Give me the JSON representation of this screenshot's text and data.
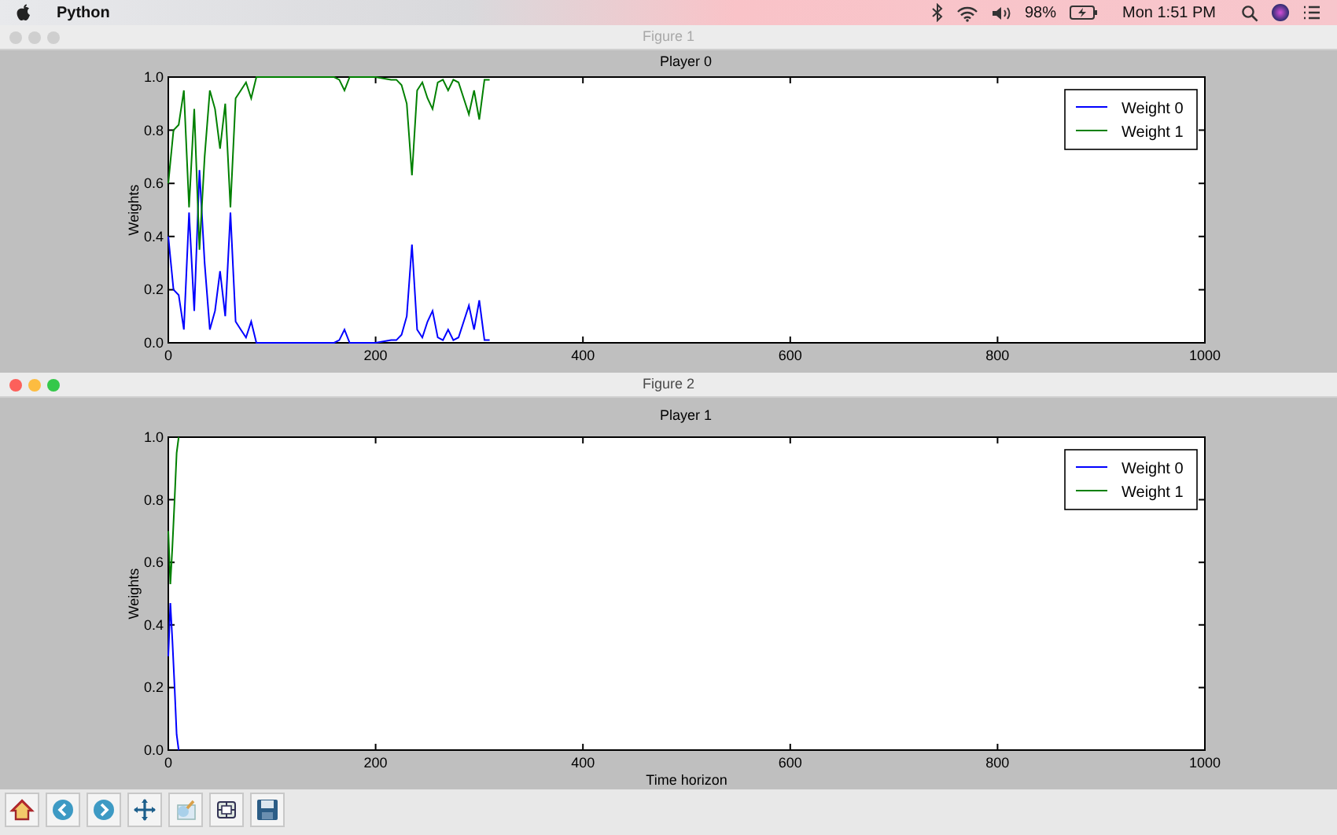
{
  "menu_bar": {
    "app_name": "Python",
    "battery_percent": "98%",
    "clock": "Mon 1:51 PM"
  },
  "windows": [
    {
      "title": "Figure 1",
      "active": false,
      "chart_data": {
        "type": "line",
        "title": "Player 0",
        "legend": "upper right",
        "ylabel": "Weights",
        "xlim": [
          0,
          1000
        ],
        "ylim": [
          0,
          1
        ],
        "xticks": [
          0,
          200,
          400,
          600,
          800,
          1000
        ],
        "yticks": [
          {
            "value": 0,
            "label": "0.0"
          },
          {
            "value": 0.2,
            "label": "0.2"
          },
          {
            "value": 0.4,
            "label": "0.4"
          },
          {
            "value": 0.6,
            "label": "0.6"
          },
          {
            "value": 0.8,
            "label": "0.8"
          },
          {
            "value": 1,
            "label": "1.0"
          }
        ],
        "x": [
          0,
          5,
          10,
          15,
          20,
          25,
          30,
          35,
          40,
          45,
          50,
          55,
          60,
          65,
          70,
          75,
          80,
          85,
          90,
          100,
          120,
          140,
          160,
          165,
          170,
          175,
          180,
          200,
          215,
          220,
          225,
          230,
          235,
          240,
          245,
          250,
          255,
          260,
          265,
          270,
          275,
          280,
          285,
          290,
          295,
          300,
          305,
          310
        ],
        "series": [
          {
            "name": "Weight 0",
            "color": "#0000ff",
            "values": [
              0.4,
              0.2,
              0.18,
              0.05,
              0.49,
              0.12,
              0.65,
              0.3,
              0.05,
              0.12,
              0.27,
              0.1,
              0.49,
              0.08,
              0.05,
              0.02,
              0.08,
              0.0,
              0.0,
              0.0,
              0.0,
              0.0,
              0.0,
              0.01,
              0.05,
              0.0,
              0.0,
              0.0,
              0.01,
              0.01,
              0.03,
              0.1,
              0.37,
              0.05,
              0.02,
              0.08,
              0.12,
              0.02,
              0.01,
              0.05,
              0.01,
              0.02,
              0.08,
              0.14,
              0.05,
              0.16,
              0.01,
              0.01
            ]
          },
          {
            "name": "Weight 1",
            "color": "#008000",
            "values": [
              0.6,
              0.8,
              0.82,
              0.95,
              0.51,
              0.88,
              0.35,
              0.7,
              0.95,
              0.88,
              0.73,
              0.9,
              0.51,
              0.92,
              0.95,
              0.98,
              0.92,
              1.0,
              1.0,
              1.0,
              1.0,
              1.0,
              1.0,
              0.99,
              0.95,
              1.0,
              1.0,
              1.0,
              0.99,
              0.99,
              0.97,
              0.9,
              0.63,
              0.95,
              0.98,
              0.92,
              0.88,
              0.98,
              0.99,
              0.95,
              0.99,
              0.98,
              0.92,
              0.86,
              0.95,
              0.84,
              0.99,
              0.99
            ]
          }
        ]
      }
    },
    {
      "title": "Figure 2",
      "active": true,
      "chart_data": {
        "type": "line",
        "title": "Player 1",
        "legend": "upper right",
        "xlabel": "Time horizon",
        "ylabel": "Weights",
        "xlim": [
          0,
          1000
        ],
        "ylim": [
          0,
          1
        ],
        "xticks": [
          0,
          200,
          400,
          600,
          800,
          1000
        ],
        "yticks": [
          {
            "value": 0,
            "label": "0.0"
          },
          {
            "value": 0.2,
            "label": "0.2"
          },
          {
            "value": 0.4,
            "label": "0.4"
          },
          {
            "value": 0.6,
            "label": "0.6"
          },
          {
            "value": 0.8,
            "label": "0.8"
          },
          {
            "value": 1,
            "label": "1.0"
          }
        ],
        "x": [
          0,
          2,
          4,
          6,
          8,
          10
        ],
        "series": [
          {
            "name": "Weight 0",
            "color": "#0000ff",
            "values": [
              0.3,
              0.47,
              0.35,
              0.2,
              0.05,
              0.0
            ]
          },
          {
            "name": "Weight 1",
            "color": "#008000",
            "values": [
              0.7,
              0.53,
              0.65,
              0.8,
              0.95,
              1.0
            ]
          }
        ]
      }
    }
  ]
}
